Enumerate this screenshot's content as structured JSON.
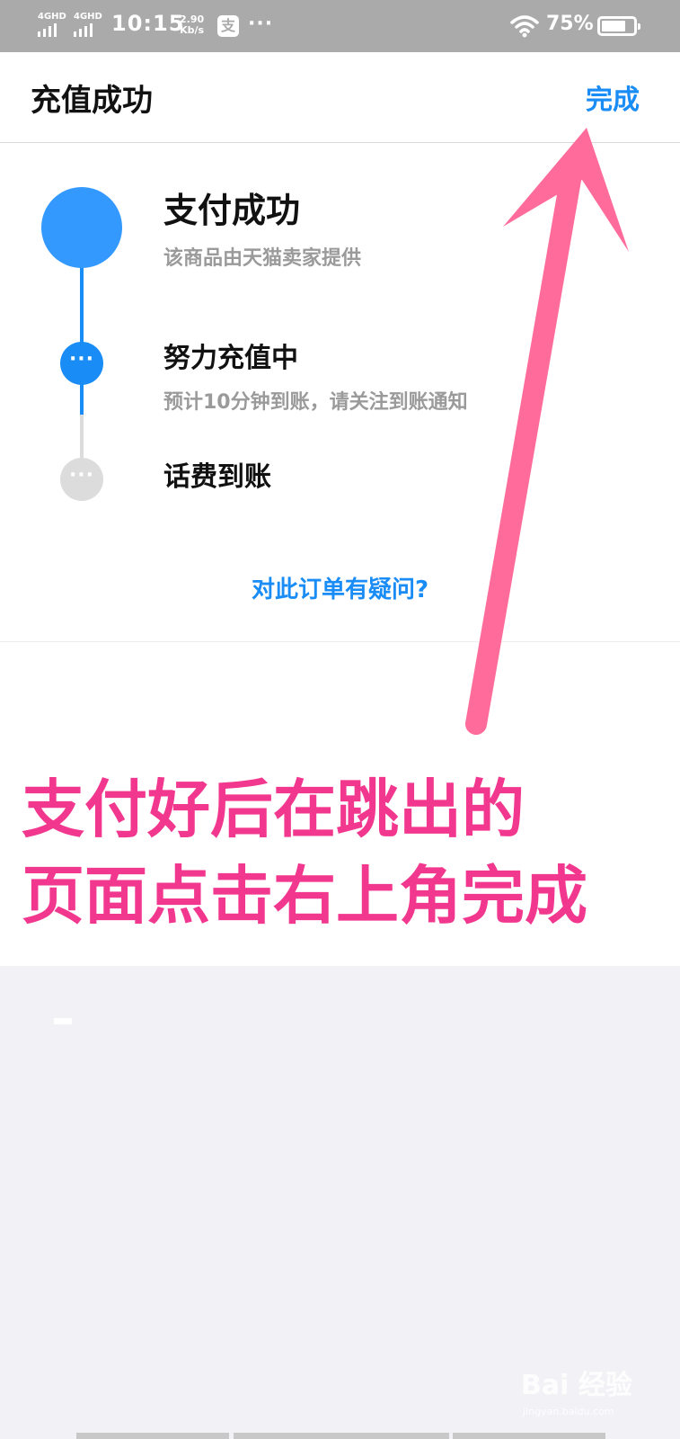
{
  "status_bar": {
    "signal1": "4GHD",
    "signal2": "4GHD",
    "time": "10:15",
    "speed_value": "2.90",
    "speed_unit": "Kb/s",
    "alipay_glyph": "支",
    "more": "···",
    "battery_percent": "75%",
    "battery_level": 0.75,
    "icons": [
      "signal-icon",
      "alipay-icon",
      "wifi-icon",
      "battery-icon"
    ]
  },
  "header": {
    "title": "充值成功",
    "done_label": "完成"
  },
  "steps": [
    {
      "title": "支付成功",
      "subtitle": "该商品由天猫卖家提供"
    },
    {
      "title": "努力充值中",
      "subtitle": "预计10分钟到账，请关注到账通知",
      "node_glyph": "···"
    },
    {
      "title": "话费到账",
      "node_glyph": "···"
    }
  ],
  "question_link": "对此订单有疑问?",
  "annotation": {
    "line1": "支付好后在跳出的",
    "line2": "页面点击右上角完成",
    "color": "#f2378f"
  },
  "watermark": {
    "logo": "Bai 经验",
    "url": "jingyan.baidu.com"
  },
  "colors": {
    "accent": "#1a8cf5",
    "arrow": "#ff6b9a"
  }
}
